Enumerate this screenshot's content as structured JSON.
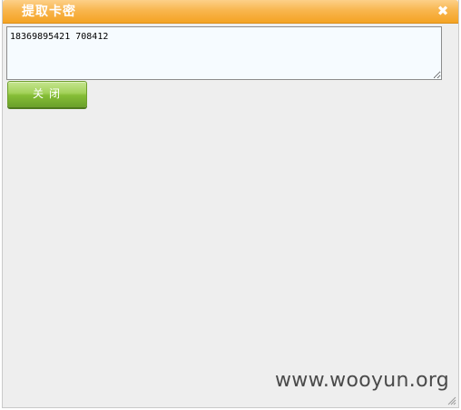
{
  "dialog": {
    "title": "提取卡密",
    "close_icon": "close-icon",
    "close_glyph": "✖"
  },
  "card_box": {
    "value": "18369895421 708412"
  },
  "actions": {
    "close_label": "关闭"
  },
  "watermark": {
    "text": "www.wooyun.org"
  },
  "colors": {
    "titlebar": "#f6a93a",
    "button": "#8cc63f",
    "dialog_bg": "#eeeeee",
    "textarea_bg": "#f6fbff"
  }
}
